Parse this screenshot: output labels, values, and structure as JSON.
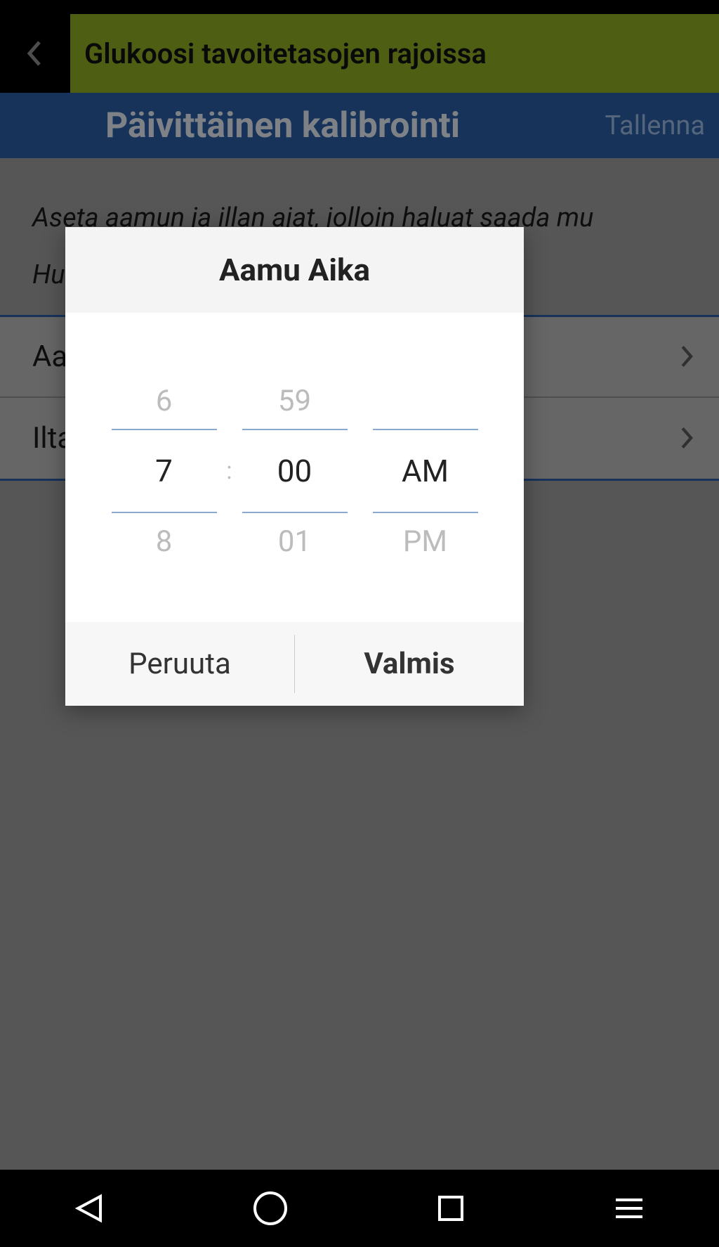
{
  "titlebar": {
    "title": "Glukoosi tavoitetasojen rajoissa"
  },
  "subheader": {
    "title": "Päivittäinen kalibrointi",
    "save": "Tallenna"
  },
  "body": {
    "instruction_line1": "Aseta aamun ja illan ajat, jolloin haluat saada mu",
    "instruction_line2": "Hu                                                          ssä on",
    "rows": [
      {
        "label": "Aa"
      },
      {
        "label": "Ilta"
      }
    ]
  },
  "dialog": {
    "title": "Aamu Aika",
    "hour": {
      "prev": "6",
      "current": "7",
      "next": "8"
    },
    "minute": {
      "prev": "59",
      "current": "00",
      "next": "01"
    },
    "ampm": {
      "prev": "",
      "current": "AM",
      "next": "PM"
    },
    "cancel": "Peruuta",
    "done": "Valmis"
  }
}
